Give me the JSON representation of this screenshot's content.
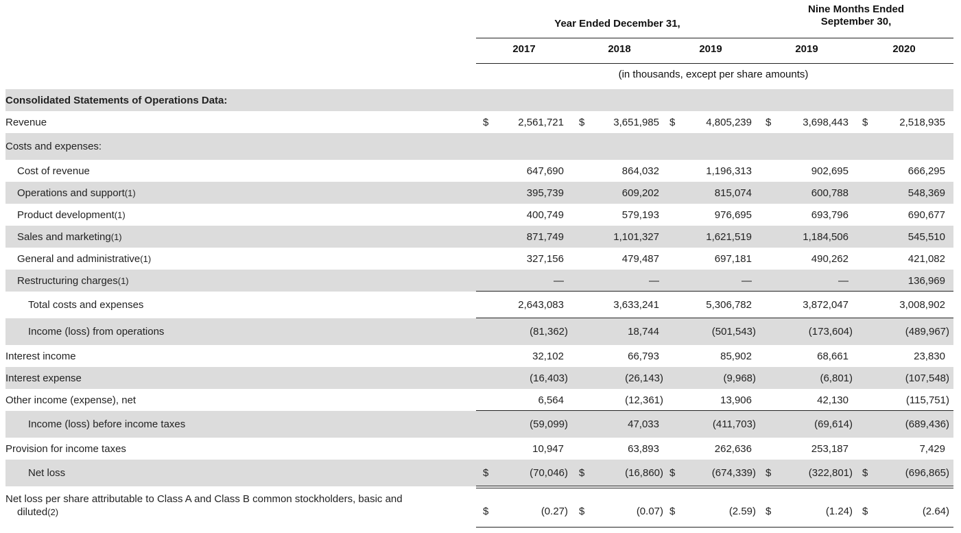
{
  "header": {
    "year_ended": "Year Ended December 31,",
    "nine_months_line1": "Nine Months Ended",
    "nine_months_line2": "September 30,",
    "years": [
      "2017",
      "2018",
      "2019",
      "2019",
      "2020"
    ],
    "units_note": "(in thousands, except per share amounts)"
  },
  "rows": [
    {
      "label": "Consolidated Statements of Operations Data:",
      "values": [
        "",
        "",
        "",
        "",
        ""
      ]
    },
    {
      "label": "Revenue",
      "values": [
        "2,561,721",
        "3,651,985",
        "4,805,239",
        "3,698,443",
        "2,518,935"
      ],
      "dollar": "$"
    },
    {
      "label": "Costs and expenses:",
      "values": [
        "",
        "",
        "",
        "",
        ""
      ]
    },
    {
      "label": "Cost of revenue",
      "values": [
        "647,690",
        "864,032",
        "1,196,313",
        "902,695",
        "666,295"
      ]
    },
    {
      "label": "Operations and support",
      "note": "(1)",
      "values": [
        "395,739",
        "609,202",
        "815,074",
        "600,788",
        "548,369"
      ]
    },
    {
      "label": "Product development",
      "note": "(1)",
      "values": [
        "400,749",
        "579,193",
        "976,695",
        "693,796",
        "690,677"
      ]
    },
    {
      "label": "Sales and marketing",
      "note": "(1)",
      "values": [
        "871,749",
        "1,101,327",
        "1,621,519",
        "1,184,506",
        "545,510"
      ]
    },
    {
      "label": "General and administrative",
      "note": "(1)",
      "values": [
        "327,156",
        "479,487",
        "697,181",
        "490,262",
        "421,082"
      ]
    },
    {
      "label": "Restructuring charges",
      "note": "(1)",
      "values": [
        "—",
        "—",
        "—",
        "—",
        "136,969"
      ]
    },
    {
      "label": "Total costs and expenses",
      "values": [
        "2,643,083",
        "3,633,241",
        "5,306,782",
        "3,872,047",
        "3,008,902"
      ]
    },
    {
      "label": "Income (loss) from operations",
      "values": [
        "(81,362)",
        "18,744",
        "(501,543)",
        "(173,604)",
        "(489,967)"
      ]
    },
    {
      "label": "Interest income",
      "values": [
        "32,102",
        "66,793",
        "85,902",
        "68,661",
        "23,830"
      ]
    },
    {
      "label": "Interest expense",
      "values": [
        "(16,403)",
        "(26,143)",
        "(9,968)",
        "(6,801)",
        "(107,548)"
      ]
    },
    {
      "label": "Other income (expense), net",
      "values": [
        "6,564",
        "(12,361)",
        "13,906",
        "42,130",
        "(115,751)"
      ]
    },
    {
      "label": "Income (loss) before income taxes",
      "values": [
        "(59,099)",
        "47,033",
        "(411,703)",
        "(69,614)",
        "(689,436)"
      ]
    },
    {
      "label": "Provision for income taxes",
      "values": [
        "10,947",
        "63,893",
        "262,636",
        "253,187",
        "7,429"
      ]
    },
    {
      "label": "Net loss",
      "values": [
        "(70,046)",
        "(16,860)",
        "(674,339)",
        "(322,801)",
        "(696,865)"
      ],
      "dollar": "$"
    },
    {
      "label": "Net loss per share attributable to Class A and Class B common stockholders, basic and",
      "label2": "diluted",
      "note": "(2)",
      "values": [
        "(0.27)",
        "(0.07)",
        "(2.59)",
        "(1.24)",
        "(2.64)"
      ],
      "dollar": "$"
    }
  ]
}
